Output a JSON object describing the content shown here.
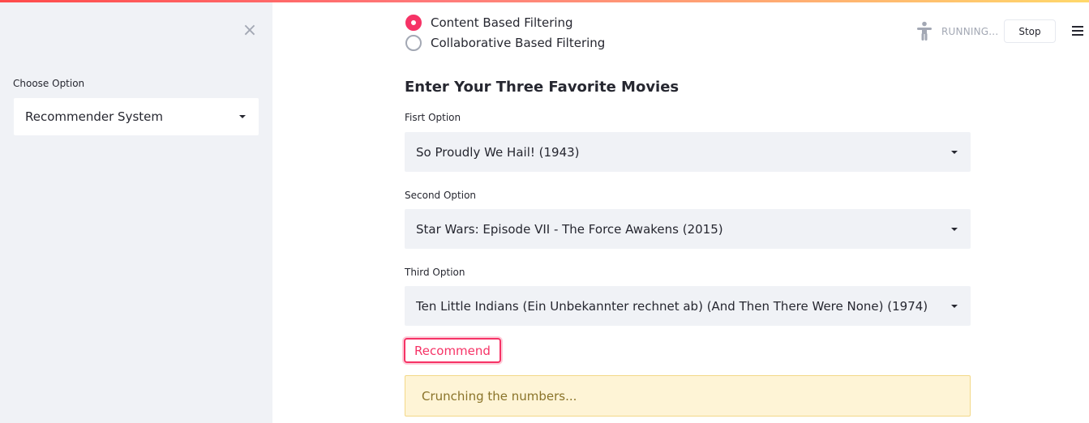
{
  "sidebar": {
    "close_glyph": "×",
    "choose_label": "Choose Option",
    "select_value": "Recommender System"
  },
  "toolbar": {
    "status_text": "RUNNING...",
    "stop_label": "Stop",
    "running_icon": "person-running-icon",
    "menu_icon": "hamburger-menu-icon"
  },
  "main": {
    "radio_options": [
      {
        "label": "Content Based Filtering",
        "checked": true
      },
      {
        "label": "Collaborative Based Filtering",
        "checked": false
      }
    ],
    "heading": "Enter Your Three Favorite Movies",
    "fields": [
      {
        "label": "Fisrt Option",
        "value": "So Proudly We Hail! (1943)"
      },
      {
        "label": "Second Option",
        "value": "Star Wars: Episode VII - The Force Awakens (2015)"
      },
      {
        "label": "Third Option",
        "value": "Ten Little Indians (Ein Unbekannter rechnet ab) (And Then There Were None) (1974)"
      }
    ],
    "recommend_label": "Recommend",
    "status_message": "Crunching the numbers..."
  },
  "colors": {
    "accent": "#f63366",
    "sidebar_bg": "#f0f2f6",
    "warning_bg": "#fef4d6",
    "warning_text": "#8a7329"
  }
}
